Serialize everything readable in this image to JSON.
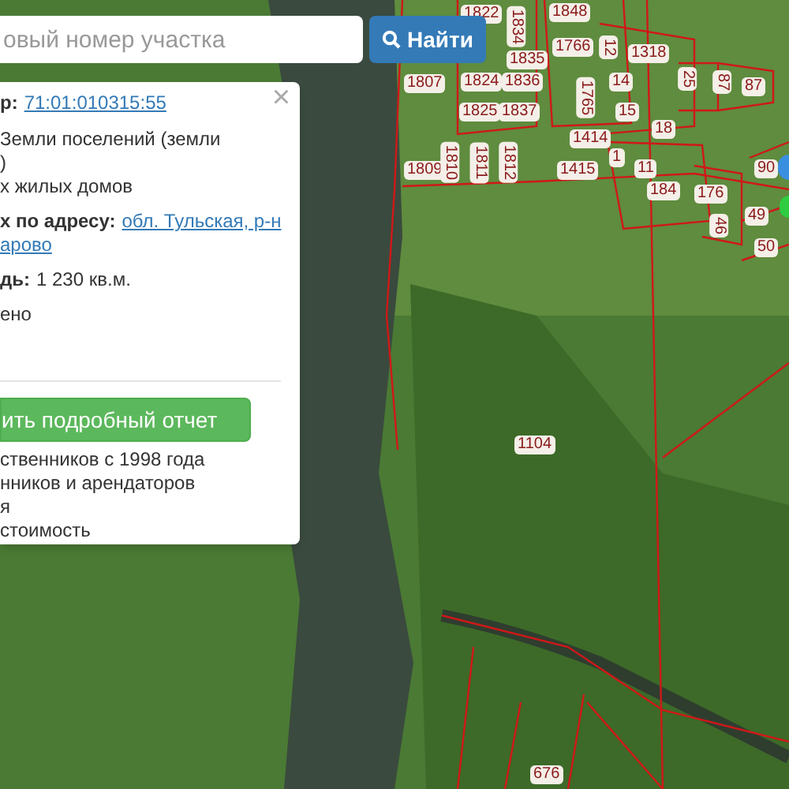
{
  "search": {
    "placeholder": "овый номер участка",
    "button": "Найти"
  },
  "popup": {
    "close": "×",
    "lines": [
      {
        "kind": "label_link",
        "label": "р:",
        "value": "71:01:010315:55"
      },
      {
        "kind": "text",
        "value": "Земли поселений (земли"
      },
      {
        "kind": "text",
        "value": ")"
      },
      {
        "kind": "text",
        "value": "х жилых домов"
      },
      {
        "kind": "label_link",
        "label": "х по адресу:",
        "value": "обл. Тульская, р-н"
      },
      {
        "kind": "link",
        "value": "арово"
      },
      {
        "kind": "label_value",
        "label": "дь:",
        "value": "1 230 кв.м."
      },
      {
        "kind": "text",
        "value": "ено"
      }
    ],
    "report_button": "ить подробный отчет",
    "features": [
      "ственников с 1998 года",
      "нников и арендаторов",
      "я",
      "стоимость"
    ]
  },
  "parcels": [
    {
      "label": "1822",
      "vertical": false
    },
    {
      "label": "1834",
      "vertical": true
    },
    {
      "label": "1848",
      "vertical": false
    },
    {
      "label": "1835",
      "vertical": false
    },
    {
      "label": "1766",
      "vertical": false
    },
    {
      "label": "12",
      "vertical": true
    },
    {
      "label": "1318",
      "vertical": false
    },
    {
      "label": "1807",
      "vertical": false
    },
    {
      "label": "1824",
      "vertical": false
    },
    {
      "label": "1836",
      "vertical": false
    },
    {
      "label": "1765",
      "vertical": true
    },
    {
      "label": "14",
      "vertical": false
    },
    {
      "label": "25",
      "vertical": true
    },
    {
      "label": "87",
      "vertical": true
    },
    {
      "label": "87",
      "vertical": false
    },
    {
      "label": "1825",
      "vertical": false
    },
    {
      "label": "1837",
      "vertical": false
    },
    {
      "label": "15",
      "vertical": false
    },
    {
      "label": "18",
      "vertical": false
    },
    {
      "label": "1414",
      "vertical": false
    },
    {
      "label": "1809",
      "vertical": false
    },
    {
      "label": "1810",
      "vertical": true
    },
    {
      "label": "1811",
      "vertical": true
    },
    {
      "label": "1812",
      "vertical": true
    },
    {
      "label": "1415",
      "vertical": false
    },
    {
      "label": "1",
      "vertical": false
    },
    {
      "label": "11",
      "vertical": false
    },
    {
      "label": "184",
      "vertical": false
    },
    {
      "label": "176",
      "vertical": false
    },
    {
      "label": "46",
      "vertical": true
    },
    {
      "label": "90",
      "vertical": false
    },
    {
      "label": "49",
      "vertical": false
    },
    {
      "label": "50",
      "vertical": false
    },
    {
      "label": "1104",
      "vertical": false
    },
    {
      "label": "676",
      "vertical": false
    }
  ]
}
